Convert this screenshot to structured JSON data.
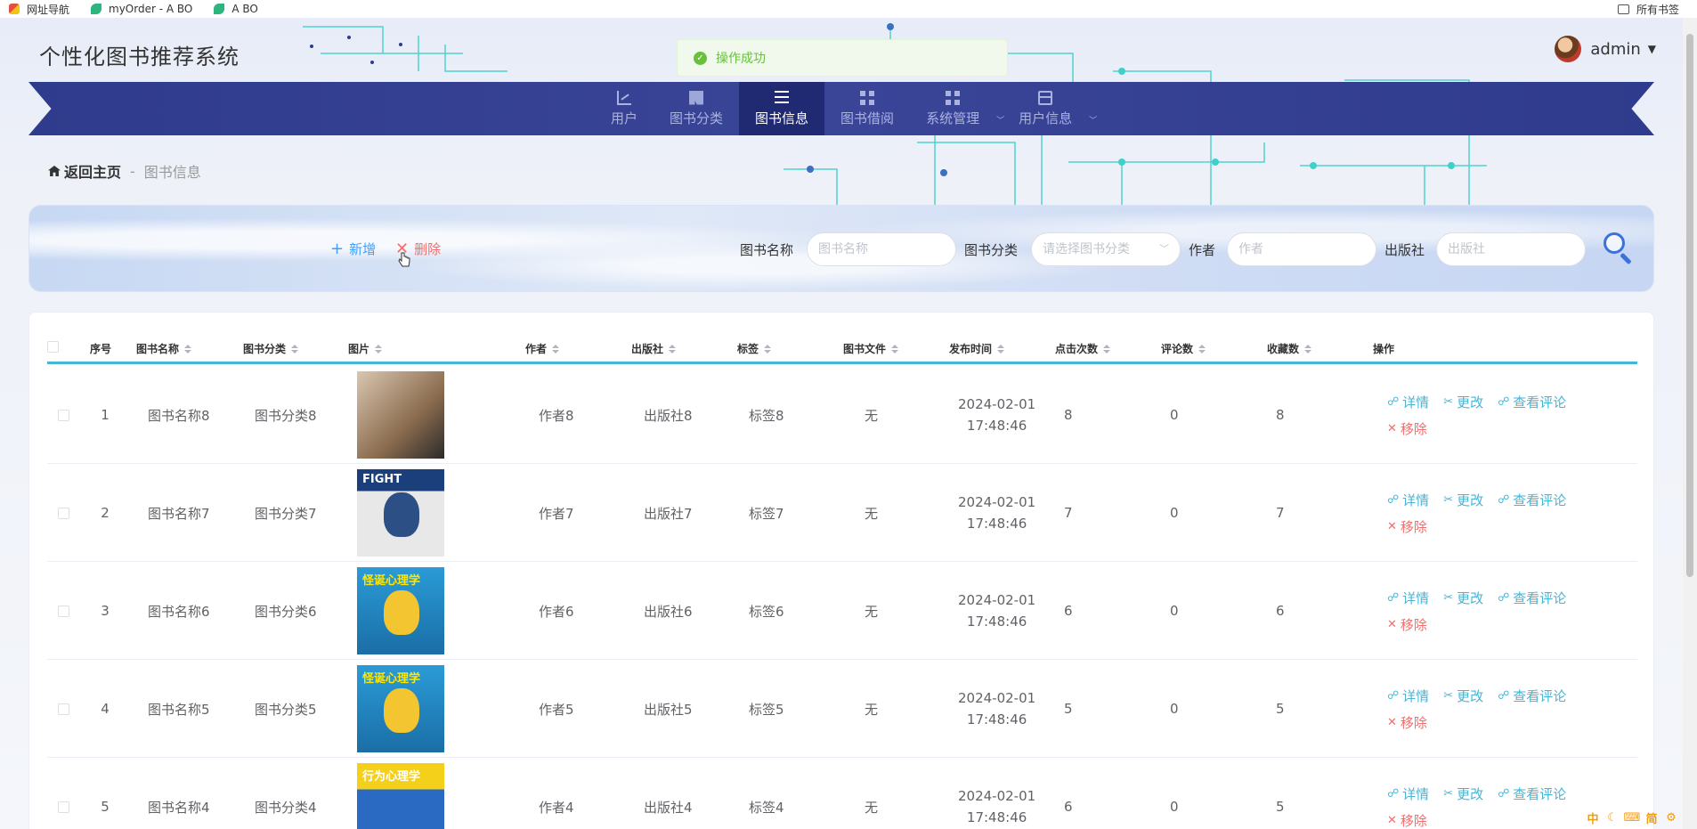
{
  "browser": {
    "bookmarks": [
      {
        "label": "网址导航",
        "icon": "grid-icon"
      },
      {
        "label": "myOrder - A BO",
        "icon": "leaf-icon"
      },
      {
        "label": "A BO",
        "icon": "leaf-icon"
      }
    ],
    "all_bookmarks": "所有书签"
  },
  "header": {
    "title": "个性化图书推荐系统",
    "user": "admin"
  },
  "toast": {
    "message": "操作成功",
    "color": "#67c23a"
  },
  "nav": {
    "items": [
      {
        "label": "用户",
        "icon": "chart-icon",
        "active": false,
        "dropdown": false
      },
      {
        "label": "图书分类",
        "icon": "book-icon",
        "active": false,
        "dropdown": false
      },
      {
        "label": "图书信息",
        "icon": "list-icon",
        "active": true,
        "dropdown": false
      },
      {
        "label": "图书借阅",
        "icon": "grid-icon",
        "active": false,
        "dropdown": false
      },
      {
        "label": "系统管理",
        "icon": "grid-icon",
        "active": false,
        "dropdown": true
      },
      {
        "label": "用户信息",
        "icon": "card-icon",
        "active": false,
        "dropdown": true
      }
    ],
    "background": "#2f3b8c"
  },
  "breadcrumb": {
    "home": "返回主页",
    "separator": "-",
    "current": "图书信息"
  },
  "toolbar": {
    "add_label": "新增",
    "delete_label": "删除"
  },
  "search": {
    "book_name": {
      "label": "图书名称",
      "placeholder": "图书名称"
    },
    "category": {
      "label": "图书分类",
      "placeholder": "请选择图书分类"
    },
    "author": {
      "label": "作者",
      "placeholder": "作者"
    },
    "publisher": {
      "label": "出版社",
      "placeholder": "出版社"
    }
  },
  "table": {
    "columns": [
      "序号",
      "图书名称",
      "图书分类",
      "图片",
      "作者",
      "出版社",
      "标签",
      "图书文件",
      "发布时间",
      "点击次数",
      "评论数",
      "收藏数",
      "操作"
    ],
    "actions": {
      "detail": "详情",
      "edit": "更改",
      "comments": "查看评论",
      "remove": "移除"
    },
    "rows": [
      {
        "no": "1",
        "name": "图书名称8",
        "category": "图书分类8",
        "author": "作者8",
        "publisher": "出版社8",
        "tag": "标签8",
        "file": "无",
        "date": "2024-02-01",
        "time": "17:48:46",
        "clicks": "8",
        "comments": "0",
        "favorites": "8",
        "cover": "photo-book"
      },
      {
        "no": "2",
        "name": "图书名称7",
        "category": "图书分类7",
        "author": "作者7",
        "publisher": "出版社7",
        "tag": "标签7",
        "file": "无",
        "date": "2024-02-01",
        "time": "17:48:46",
        "clicks": "7",
        "comments": "0",
        "favorites": "7",
        "cover": "fight-book",
        "cover_text": "FIGHT"
      },
      {
        "no": "3",
        "name": "图书名称6",
        "category": "图书分类6",
        "author": "作者6",
        "publisher": "出版社6",
        "tag": "标签6",
        "file": "无",
        "date": "2024-02-01",
        "time": "17:48:46",
        "clicks": "6",
        "comments": "0",
        "favorites": "6",
        "cover": "psychology-book",
        "cover_text": "怪诞心理学"
      },
      {
        "no": "4",
        "name": "图书名称5",
        "category": "图书分类5",
        "author": "作者5",
        "publisher": "出版社5",
        "tag": "标签5",
        "file": "无",
        "date": "2024-02-01",
        "time": "17:48:46",
        "clicks": "5",
        "comments": "0",
        "favorites": "5",
        "cover": "psychology-book",
        "cover_text": "怪诞心理学"
      },
      {
        "no": "5",
        "name": "图书名称4",
        "category": "图书分类4",
        "author": "作者4",
        "publisher": "出版社4",
        "tag": "标签4",
        "file": "无",
        "date": "2024-02-01",
        "time": "17:48:46",
        "clicks": "6",
        "comments": "0",
        "favorites": "5",
        "cover": "behavior-book",
        "cover_text": "行为心理学"
      }
    ]
  },
  "colors": {
    "accent": "#46b5d6",
    "danger": "#f56c6c",
    "primary": "#409eff"
  }
}
